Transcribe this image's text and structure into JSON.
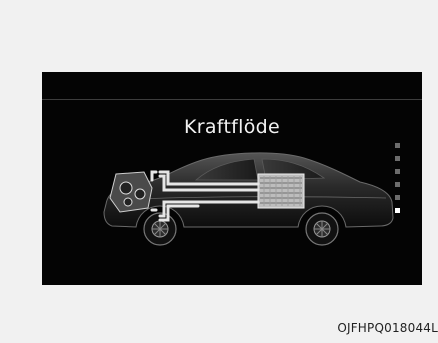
{
  "screen": {
    "title": "Kraftflöde",
    "page_indicator": {
      "total": 6,
      "current": 6
    }
  },
  "caption": "OJFHPQ018044L",
  "colors": {
    "background": "#040404",
    "page_background": "#f1f1f1",
    "title_text": "#f2f2f2",
    "flow_line": "#e6e6e6",
    "indicator_inactive": "#6c6c6c",
    "indicator_active": "#ffffff"
  },
  "icons": [
    "car-illustration",
    "engine-icon",
    "battery-icon",
    "power-flow-lines"
  ]
}
